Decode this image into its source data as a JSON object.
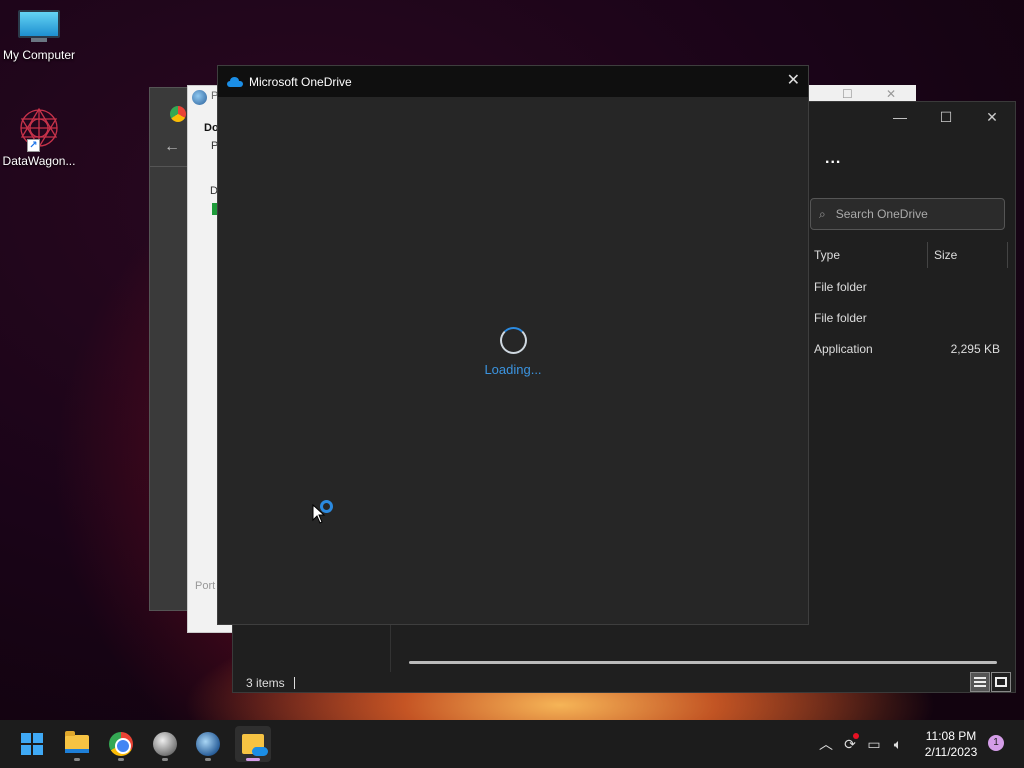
{
  "desktop": {
    "icons": [
      {
        "label": "My Computer"
      },
      {
        "label": "DataWagon..."
      }
    ]
  },
  "bg_windows": {
    "doc_title_short": "Do",
    "doc_sub_short": "P",
    "doc_line_short": "D",
    "doc_footer_short": "Port",
    "window_letter": "P"
  },
  "explorer": {
    "search_placeholder": "Search OneDrive",
    "more_label": "...",
    "columns": {
      "type": "Type",
      "size": "Size"
    },
    "rows": [
      {
        "type": "File folder",
        "size": ""
      },
      {
        "type": "File folder",
        "size": ""
      },
      {
        "type": "Application",
        "size": "2,295 KB"
      }
    ],
    "status": "3 items"
  },
  "onedrive": {
    "title": "Microsoft OneDrive",
    "loading": "Loading..."
  },
  "taskbar": {
    "apps": [
      "start-button",
      "file-explorer",
      "chrome",
      "app",
      "web-browser",
      "onedrive-folder"
    ],
    "clock_time": "11:08 PM",
    "clock_date": "2/11/2023",
    "notification_count": "1"
  },
  "colors": {
    "accent": "#2b8ae0",
    "taskbar_indicator_active": "#d49de8"
  }
}
